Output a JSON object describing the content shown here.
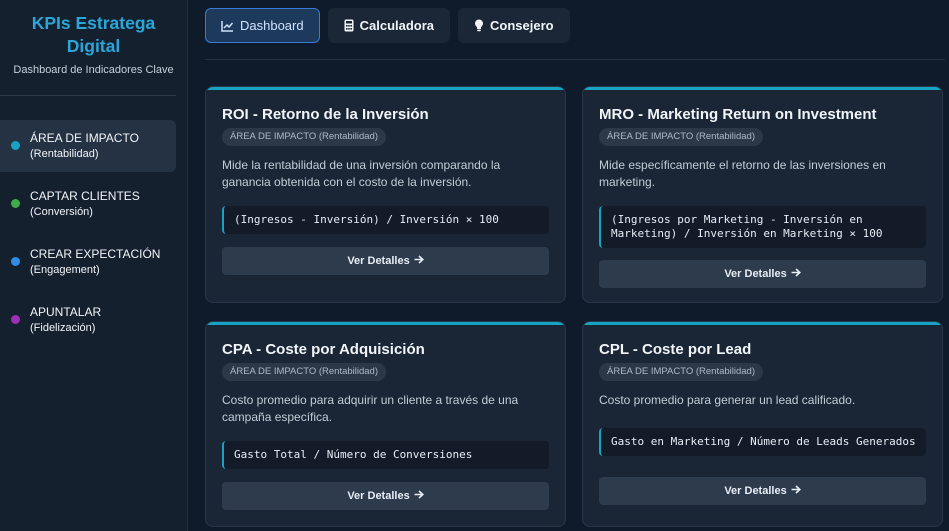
{
  "brand": {
    "title_line1": "KPIs Estratega",
    "title_line2": "Digital",
    "subtitle": "Dashboard de Indicadores Clave"
  },
  "sidebar": {
    "items": [
      {
        "title": "ÁREA DE IMPACTO",
        "sub": "(Rentabilidad)",
        "color": "#16a3c4",
        "active": true
      },
      {
        "title": "CAPTAR CLIENTES",
        "sub": "(Conversión)",
        "color": "#3fae49",
        "active": false
      },
      {
        "title": "CREAR EXPECTACIÓN",
        "sub": "(Engagement)",
        "color": "#2f8fe6",
        "active": false
      },
      {
        "title": "APUNTALAR",
        "sub": "(Fidelización)",
        "color": "#9b2fb5",
        "active": false
      }
    ]
  },
  "tabs": [
    {
      "label": "Dashboard",
      "icon": "chart-line-icon",
      "active": true
    },
    {
      "label": "Calculadora",
      "icon": "calculator-icon",
      "active": false
    },
    {
      "label": "Consejero",
      "icon": "lightbulb-icon",
      "active": false
    }
  ],
  "cards": [
    {
      "title": "ROI - Retorno de la Inversión",
      "badge": "ÁREA DE IMPACTO (Rentabilidad)",
      "description": "Mide la rentabilidad de una inversión comparando la ganancia obtenida con el costo de la inversión.",
      "formula": "(Ingresos - Inversión) / Inversión × 100",
      "button": "Ver Detalles"
    },
    {
      "title": "MRO - Marketing Return on Investment",
      "badge": "ÁREA DE IMPACTO (Rentabilidad)",
      "description": "Mide específicamente el retorno de las inversiones en marketing.",
      "formula": "(Ingresos por Marketing - Inversión en Marketing) / Inversión en Marketing × 100",
      "button": "Ver Detalles"
    },
    {
      "title": "CPA - Coste por Adquisición",
      "badge": "ÁREA DE IMPACTO (Rentabilidad)",
      "description": "Costo promedio para adquirir un cliente a través de una campaña específica.",
      "formula": "Gasto Total / Número de Conversiones",
      "button": "Ver Detalles"
    },
    {
      "title": "CPL - Coste por Lead",
      "badge": "ÁREA DE IMPACTO (Rentabilidad)",
      "description": "Costo promedio para generar un lead calificado.",
      "formula": "Gasto en Marketing / Número de Leads Generados",
      "button": "Ver Detalles"
    }
  ],
  "button_icon": "arrow-right-icon"
}
